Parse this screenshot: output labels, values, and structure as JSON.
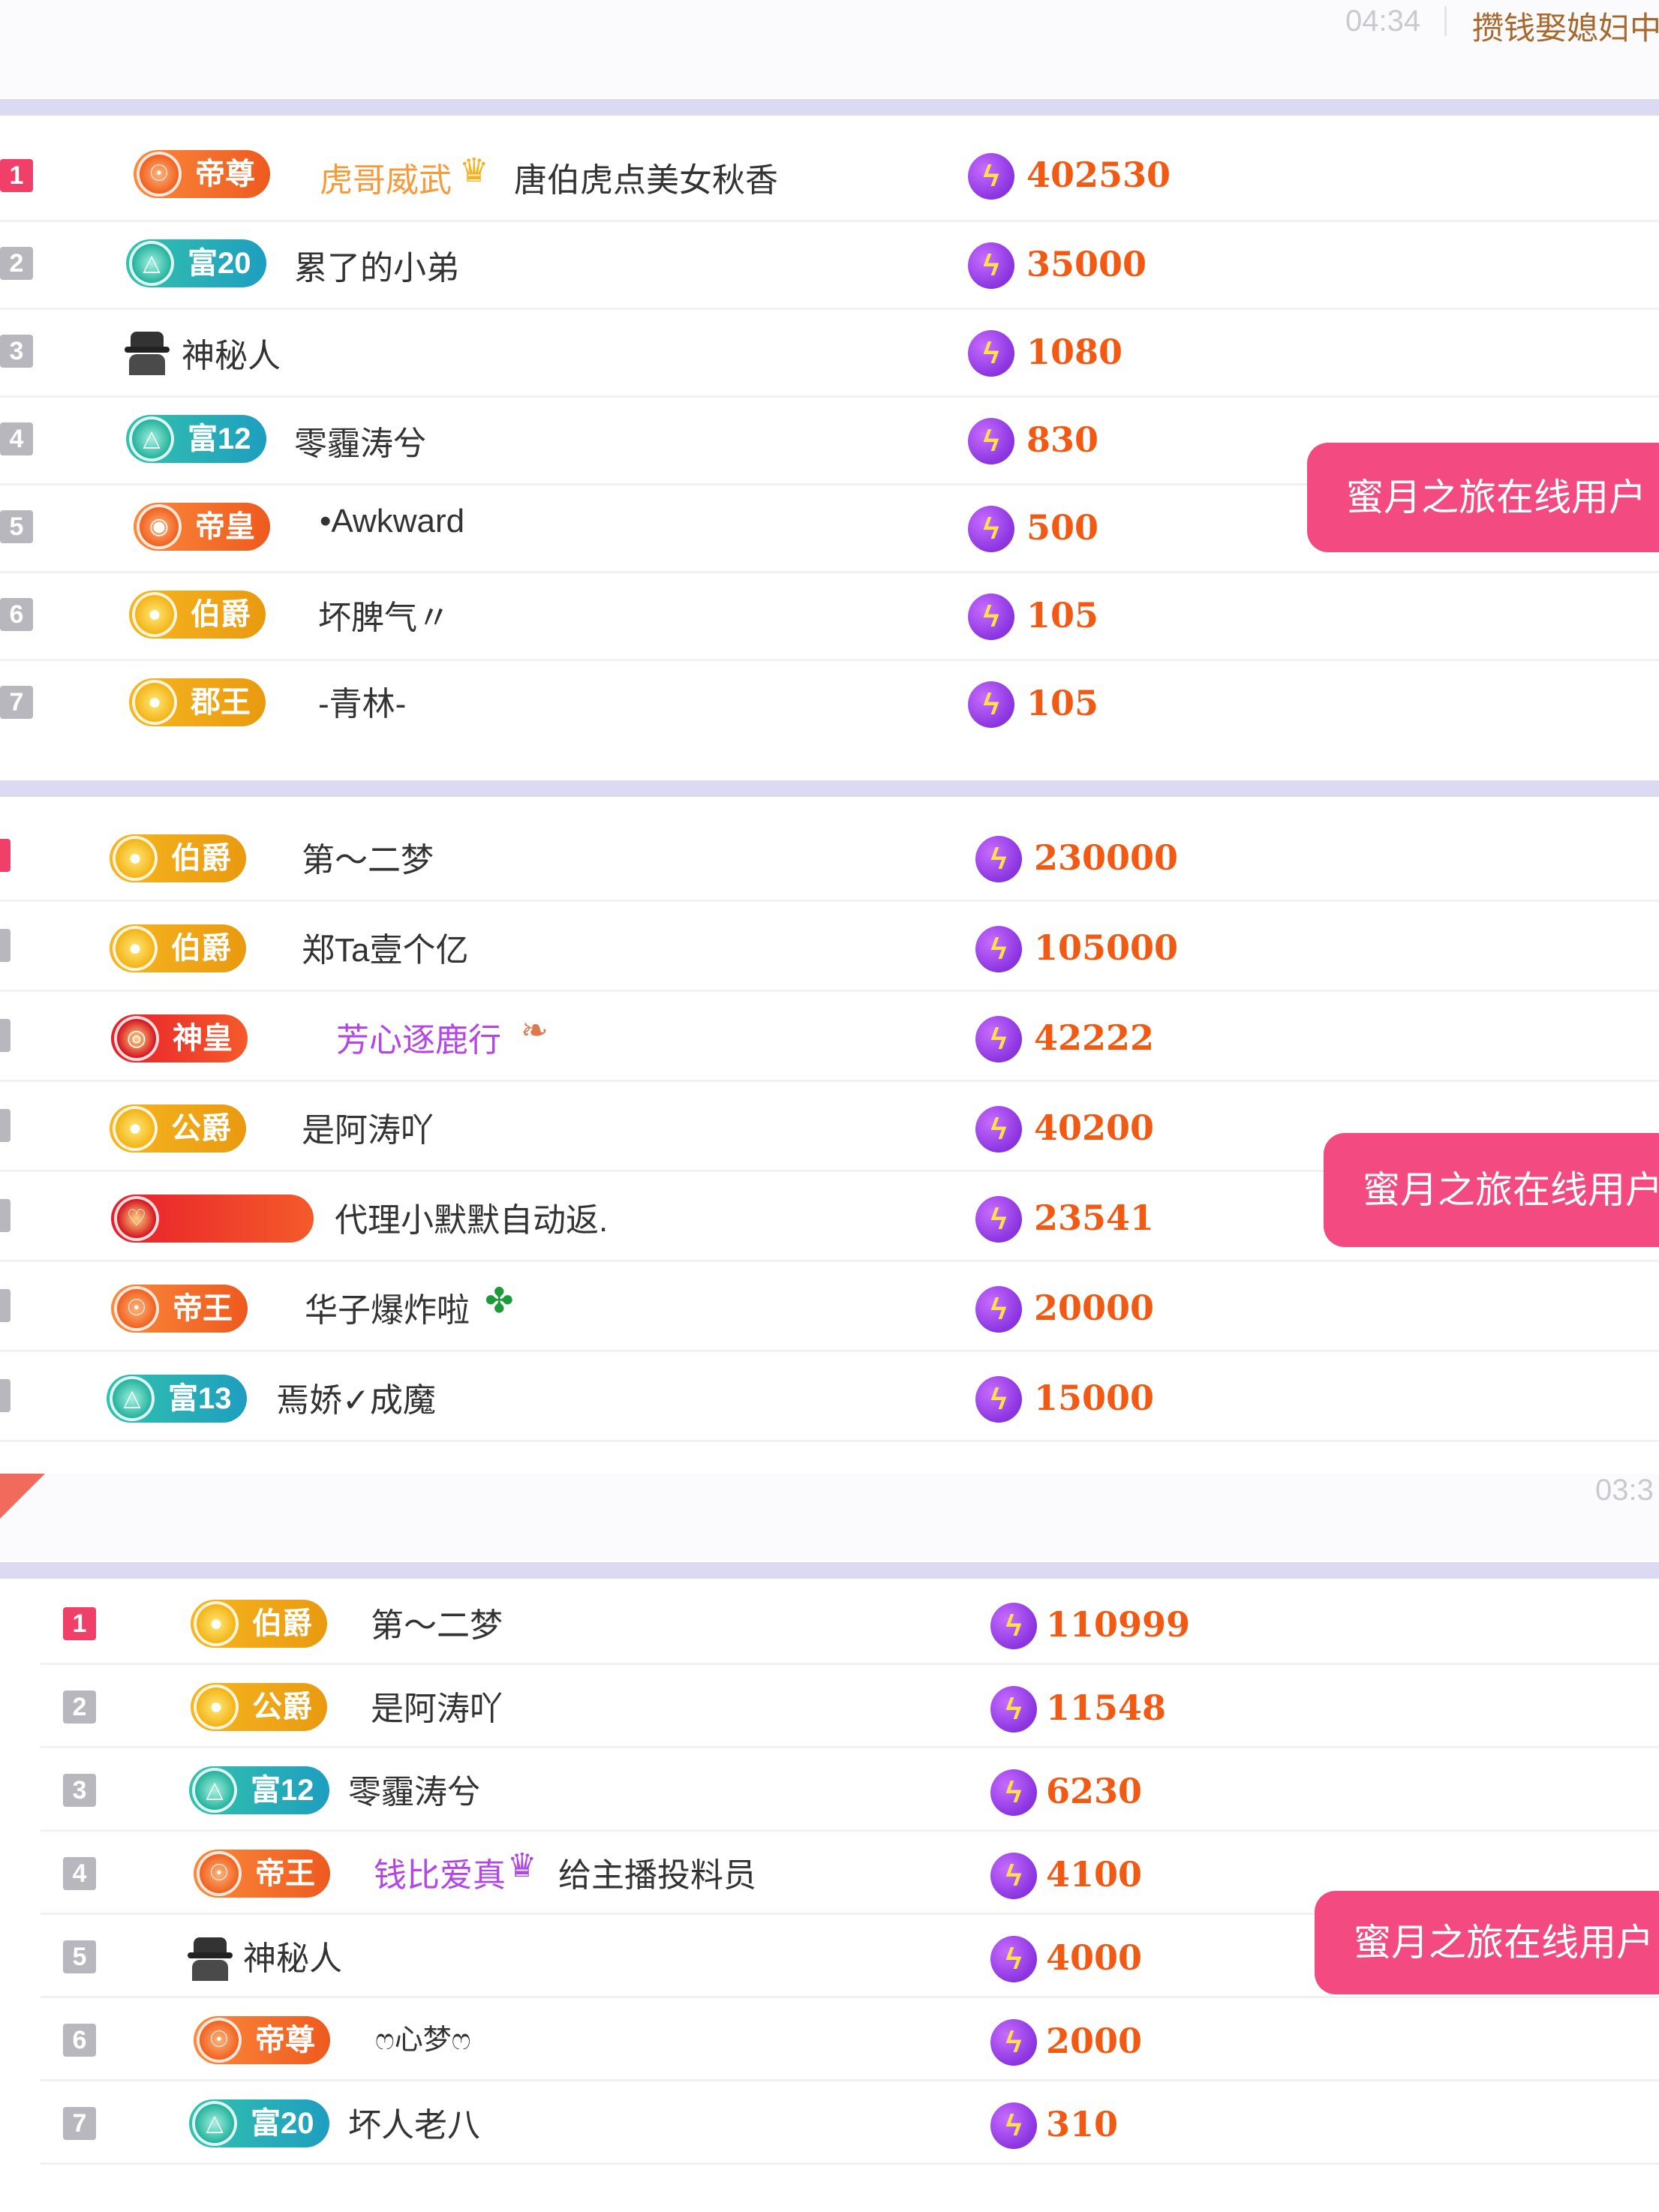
{
  "panel1": {
    "time": "04:34",
    "anchor": "攒钱娶媳妇中",
    "button": "蜜月之旅在线用户",
    "rows": [
      {
        "rank": "1",
        "badge": "帝尊",
        "badge_style": "orange",
        "pre": "虎哥威武",
        "mid_icon": "crown-icon",
        "name": "唐伯虎点美女秋香",
        "value": "402530"
      },
      {
        "rank": "2",
        "badge": "富20",
        "badge_style": "teal",
        "name": "累了的小弟",
        "value": "35000"
      },
      {
        "rank": "3",
        "badge": "",
        "badge_style": "spy",
        "name": "神秘人",
        "value": "1080"
      },
      {
        "rank": "4",
        "badge": "富12",
        "badge_style": "teal",
        "name": "零霾涛兮",
        "value": "830"
      },
      {
        "rank": "5",
        "badge": "帝皇",
        "badge_style": "orange",
        "name": "•Awkward",
        "value": "500"
      },
      {
        "rank": "6",
        "badge": "伯爵",
        "badge_style": "gold",
        "name": "坏脾气〃",
        "value": "105"
      },
      {
        "rank": "7",
        "badge": "郡王",
        "badge_style": "gold",
        "name": "-青林-",
        "value": "105"
      }
    ]
  },
  "panel2": {
    "button": "蜜月之旅在线用户",
    "rows": [
      {
        "badge": "伯爵",
        "badge_style": "gold",
        "name": "第～二梦",
        "value": "230000"
      },
      {
        "badge": "伯爵",
        "badge_style": "gold",
        "name": "郑Ta壹个亿",
        "value": "105000"
      },
      {
        "badge": "神皇",
        "badge_style": "red",
        "name": "芳心逐鹿行",
        "name_color": "purple",
        "value": "42222"
      },
      {
        "badge": "公爵",
        "badge_style": "gold",
        "name": "是阿涛吖",
        "value": "40200"
      },
      {
        "badge": "",
        "badge_style": "red",
        "name": "代理小默默自动返.",
        "value": "23541"
      },
      {
        "badge": "帝王",
        "badge_style": "orange",
        "name": "华子爆炸啦",
        "value": "20000"
      },
      {
        "badge": "富13",
        "badge_style": "teal",
        "name": "焉娇✓成魔",
        "value": "15000"
      }
    ]
  },
  "panel3": {
    "time": "03:3",
    "button": "蜜月之旅在线用户",
    "rows": [
      {
        "rank": "1",
        "badge": "伯爵",
        "badge_style": "gold",
        "name": "第～二梦",
        "value": "110999"
      },
      {
        "rank": "2",
        "badge": "公爵",
        "badge_style": "gold",
        "name": "是阿涛吖",
        "value": "11548"
      },
      {
        "rank": "3",
        "badge": "富12",
        "badge_style": "teal",
        "name": "零霾涛兮",
        "value": "6230"
      },
      {
        "rank": "4",
        "badge": "帝王",
        "badge_style": "orange",
        "pre": "钱比爱真",
        "name": "给主播投料员",
        "value": "4100"
      },
      {
        "rank": "5",
        "badge": "",
        "badge_style": "spy",
        "name": "神秘人",
        "value": "4000"
      },
      {
        "rank": "6",
        "badge": "帝尊",
        "badge_style": "orange",
        "name": "ෆ心梦ෆ",
        "value": "2000"
      },
      {
        "rank": "7",
        "badge": "富20",
        "badge_style": "teal",
        "name": "坏人老八",
        "value": "310"
      }
    ]
  },
  "icons": {
    "currency": "lightning-coin-icon",
    "rank_medal": "medal-icon"
  }
}
